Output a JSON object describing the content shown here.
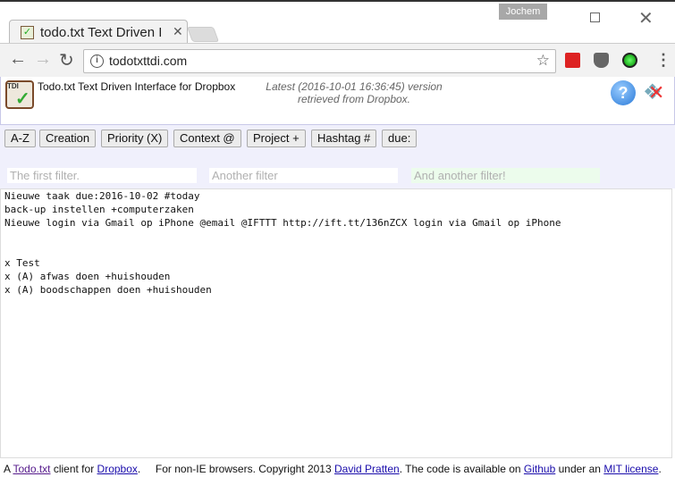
{
  "browser": {
    "user": "Jochem",
    "tab_title": "todo.txt Text Driven Interface for Dropbox",
    "url": "todotxttdi.com",
    "icons": [
      "back-icon",
      "forward-icon",
      "reload-icon",
      "info-icon",
      "star-icon",
      "lastpass-icon",
      "pocket-icon",
      "green-dot-icon",
      "menu-icon"
    ]
  },
  "header": {
    "logo_text": "TDI",
    "title": "Todo.txt Text Driven Interface for Dropbox",
    "version_line1": "Latest (2016-10-01 16:36:45) version",
    "version_line2": "retrieved from Dropbox.",
    "help": "?"
  },
  "sort_buttons": [
    "A-Z",
    "Creation",
    "Priority (X)",
    "Context @",
    "Project +",
    "Hashtag #",
    "due:"
  ],
  "filters": [
    {
      "placeholder": "The first filter."
    },
    {
      "placeholder": "Another filter"
    },
    {
      "placeholder": "And another filter!"
    }
  ],
  "todo_text": "Nieuwe taak due:2016-10-02 #today\nback-up instellen +computerzaken\nNieuwe login via Gmail op iPhone @email @IFTTT http://ift.tt/136nZCX login via Gmail op iPhone\n\n\nx Test\nx (A) afwas doen +huishouden\nx (A) boodschappen doen +huishouden",
  "footer": {
    "t1": "A ",
    "l1": "Todo.txt",
    "t2": " client for ",
    "l2": "Dropbox",
    "t3": ".     For non-IE browsers. Copyright 2013 ",
    "l3": "David Pratten",
    "t4": ". The code is available on ",
    "l4": "Github",
    "t5": " under an ",
    "l5": "MIT license",
    "t6": "."
  }
}
